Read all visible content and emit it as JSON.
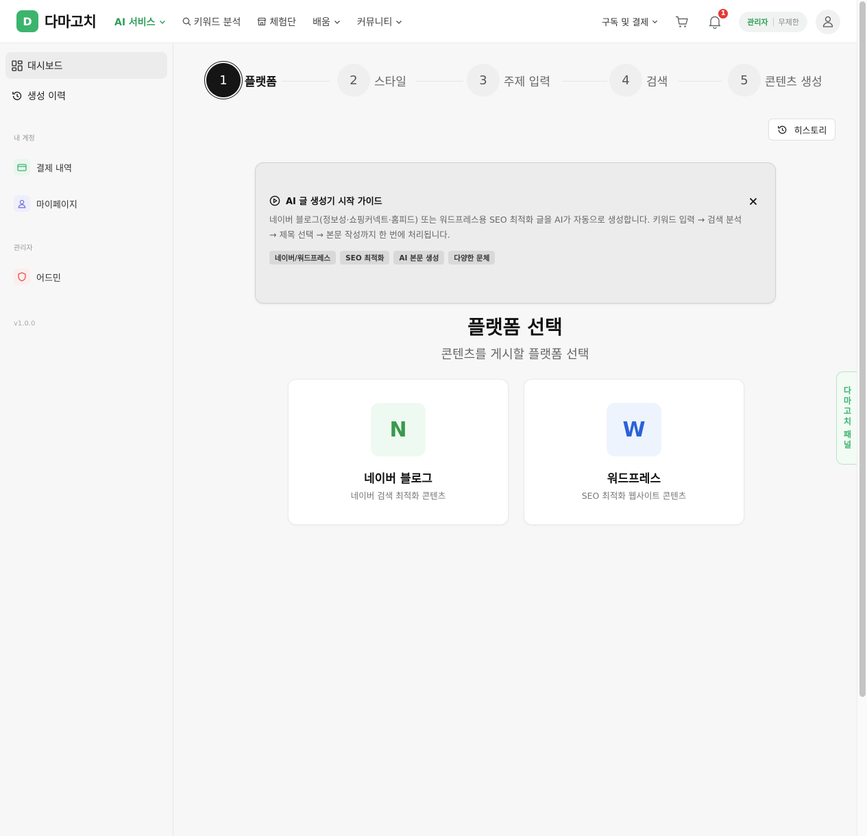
{
  "header": {
    "logo_letter": "D",
    "logo_text": "다마고치",
    "nav": [
      {
        "label": "AI 서비스",
        "active": true
      },
      {
        "label": "키워드 분석"
      },
      {
        "label": "체험단"
      },
      {
        "label": "배움"
      },
      {
        "label": "커뮤니티"
      }
    ],
    "subscribe_label": "구독 및 결제",
    "notification_count": "1",
    "role": "관리자",
    "plan": "무제한"
  },
  "sidebar": {
    "items": [
      {
        "label": "대시보드",
        "active": true
      },
      {
        "label": "생성 이력"
      }
    ],
    "section_account": "내 계정",
    "account_items": [
      {
        "label": "결제 내역"
      },
      {
        "label": "마이페이지"
      }
    ],
    "section_admin": "관리자",
    "admin_items": [
      {
        "label": "어드민"
      }
    ],
    "version": "v1.0.0"
  },
  "stepper": {
    "steps": [
      {
        "number": "1",
        "label": "플랫폼",
        "active": true
      },
      {
        "number": "2",
        "label": "스타일"
      },
      {
        "number": "3",
        "label": "주제 입력"
      },
      {
        "number": "4",
        "label": "검색"
      },
      {
        "number": "5",
        "label": "콘텐츠 생성"
      }
    ]
  },
  "history_button": "히스토리",
  "guide": {
    "title": "AI 글 생성기 시작 가이드",
    "description": "네이버 블로그(정보성·쇼핑커넥트·홈피드) 또는 워드프레스용 SEO 최적화 글을 AI가 자동으로 생성합니다. 키워드 입력 → 검색 분석 → 제목 선택 → 본문 작성까지 한 번에 처리됩니다.",
    "tags": [
      "네이버/워드프레스",
      "SEO 최적화",
      "AI 본문 생성",
      "다양한 문체"
    ]
  },
  "platform_section": {
    "title": "플랫폼 선택",
    "subtitle": "콘텐츠를 게시할 플랫폼 선택",
    "cards": [
      {
        "letter": "N",
        "title": "네이버 블로그",
        "desc": "네이버 검색 최적화 콘텐츠",
        "color": "#3a9a4c",
        "bg": "#eefaf1"
      },
      {
        "letter": "W",
        "title": "워드프레스",
        "desc": "SEO 최적화 웹사이트 콘텐츠",
        "color": "#2a62d9",
        "bg": "#eef4fe"
      }
    ]
  },
  "side_panel_tab": [
    "다",
    "마",
    "고",
    "치",
    "패",
    "널"
  ],
  "colors": {
    "brand": "#3cb46e",
    "accent_text": "#2f9e5a",
    "badge": "#e53935"
  }
}
